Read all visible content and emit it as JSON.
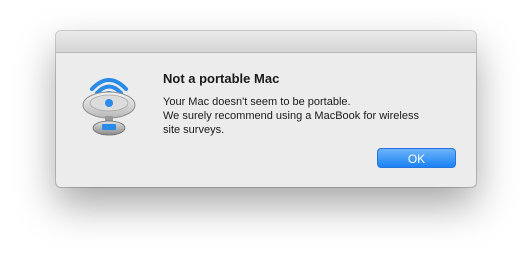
{
  "dialog": {
    "title": "Not a portable Mac",
    "message_lines": [
      "Your Mac doesn't seem to be portable.",
      "We surely recommend using a MacBook for wireless",
      "site surveys."
    ],
    "ok_label": "OK",
    "app_icon": "wifi-dish-icon"
  },
  "colors": {
    "button_top": "#6cb3fa",
    "button_bottom": "#1b82f3",
    "window_bg": "#ececec"
  }
}
